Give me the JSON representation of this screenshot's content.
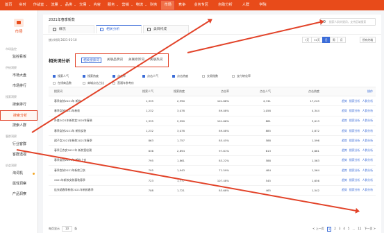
{
  "topnav": [
    "首页",
    "实时",
    "作战室",
    "流量",
    "品类",
    "交易",
    "内容",
    "服务",
    "营销",
    "物流",
    "财务",
    "市场",
    "竞争",
    "业务专区",
    "自助分析",
    "人群",
    "学院"
  ],
  "sidebar": {
    "title": "市场",
    "groups": [
      {
        "label": "市场监控",
        "items": [
          "监控看板"
        ]
      },
      {
        "label": "供给洞察",
        "items": [
          "市场大盘",
          "市场排行"
        ]
      },
      {
        "label": "搜索洞察",
        "items": [
          "搜索排行",
          "搜索分析",
          "搜索人群"
        ]
      },
      {
        "label": "客群洞察",
        "items": [
          "行业客群",
          "客群透视"
        ]
      },
      {
        "label": "机会洞察",
        "items": [
          "淘词机",
          "属性洞察",
          "产品洞察"
        ]
      }
    ],
    "active": "搜索分析"
  },
  "header": {
    "title": "2021年春季新款",
    "tabs": [
      "概况",
      "相关分析",
      "类目构成"
    ],
    "active_tab": "相关分析",
    "search_placeholder": "搜索人群关键词，支持区域搜索"
  },
  "stat": {
    "date": "统计时间 2021-01-10",
    "ranges": [
      "7天",
      "30天",
      "日",
      "周",
      "月"
    ],
    "active_range": "日",
    "terminal": "所有终端"
  },
  "analysis": {
    "title": "相关词分析",
    "sub_tabs": [
      "相关搜索词",
      "关联品牌词",
      "关联修饰词",
      "关联热词"
    ],
    "active": "相关搜索词"
  },
  "metrics": [
    [
      {
        "label": "搜索人气",
        "on": true
      },
      {
        "label": "搜索热度",
        "on": true
      },
      {
        "label": "点击率",
        "on": true
      },
      {
        "label": "点击人气",
        "on": true
      },
      {
        "label": "点击热度",
        "on": true
      },
      {
        "label": "交易指数",
        "on": false
      },
      {
        "label": "支付转化率",
        "on": false
      }
    ],
    [
      {
        "label": "在线商品数",
        "on": false
      },
      {
        "label": "商城点击占比",
        "on": false
      },
      {
        "label": "直通车参考价",
        "on": false
      }
    ]
  ],
  "table": {
    "headers": [
      "搜索词",
      "搜索人气",
      "搜索热度",
      "点击率",
      "点击人气",
      "点击热度",
      "操作"
    ],
    "rows": [
      [
        "春季女装2021年 新款",
        "1,335",
        "2,990",
        "101.66%",
        "4,741",
        "17,245"
      ],
      [
        "春季女装2021年新款",
        "1,232",
        "3,078",
        "89.08%",
        "1,058",
        "4,344"
      ],
      [
        "外套2021年新款女2020年春装",
        "1,335",
        "2,990",
        "101.66%",
        "881",
        "3,013"
      ],
      [
        "春季女装2021年 新款女装",
        "1,232",
        "3,078",
        "89.08%",
        "885",
        "2,872"
      ],
      [
        "裙子女2021年新款2021年春季",
        "863",
        "1,757",
        "85.45%",
        "588",
        "1,596"
      ],
      [
        "春季卫衣女2021年 新款宽松潮",
        "836",
        "2,894",
        "97.81%",
        "613",
        "2,661"
      ],
      [
        "春季女装2021年 新款上衣",
        "795",
        "1,861",
        "83.22%",
        "588",
        "1,563"
      ],
      [
        "春季女装2021年新款卫衣",
        "795",
        "1,943",
        "71.59%",
        "484",
        "1,564"
      ],
      [
        "2021年新款女装春装春季",
        "723",
        "1,777",
        "107.48%",
        "545",
        "1,656"
      ],
      [
        "连衣裙春季新款2021年新款春季",
        "708",
        "1,721",
        "83.68%",
        "465",
        "1,542"
      ]
    ],
    "actions": [
      "趋势",
      "搜索分析",
      "人群分析"
    ]
  },
  "pager": {
    "page_size_label": "每页显示",
    "page_size": "10",
    "unit": "条",
    "prev": "< 上一页",
    "pages": [
      "1",
      "2",
      "3",
      "4",
      "5"
    ],
    "ellipsis": "...",
    "last": "11",
    "next": "下一页 >",
    "active": "1"
  },
  "colors": {
    "brand": "#e84b1a",
    "accent": "#3b6cd8",
    "highlight": "#e24329"
  }
}
